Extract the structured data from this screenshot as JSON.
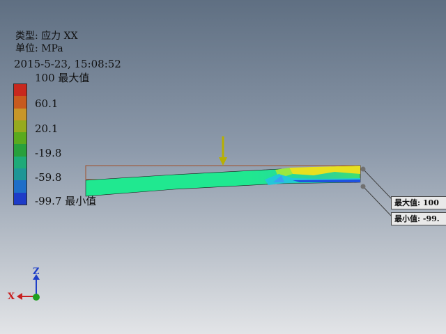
{
  "legend": {
    "type_line": "类型: 应力 XX",
    "unit_line": "单位: MPa",
    "timestamp": "2015-5-23, 15:08:52",
    "ticks": [
      {
        "value_label": "100 最大值"
      },
      {
        "value_label": "60.1"
      },
      {
        "value_label": "20.1"
      },
      {
        "value_label": "-19.8"
      },
      {
        "value_label": "-59.8"
      },
      {
        "value_label": "-99.7 最小值"
      }
    ],
    "colors": [
      "#c8281e",
      "#c85a1e",
      "#c89628",
      "#96aa1e",
      "#5aaa1e",
      "#28a03c",
      "#1eaa78",
      "#1e9696",
      "#1e6ec8",
      "#1e3cc8"
    ],
    "max": 100,
    "min": -99.7
  },
  "callouts": {
    "max_label": "最大值: 100",
    "min_label": "最小值: -99."
  },
  "triad": {
    "x_label": "X",
    "z_label": "Z"
  },
  "colors": {
    "background_top": "#5f6f82",
    "background_bottom": "#e2e4e7",
    "beam_base": "#20e890",
    "load_arrow": "#b8b000"
  }
}
